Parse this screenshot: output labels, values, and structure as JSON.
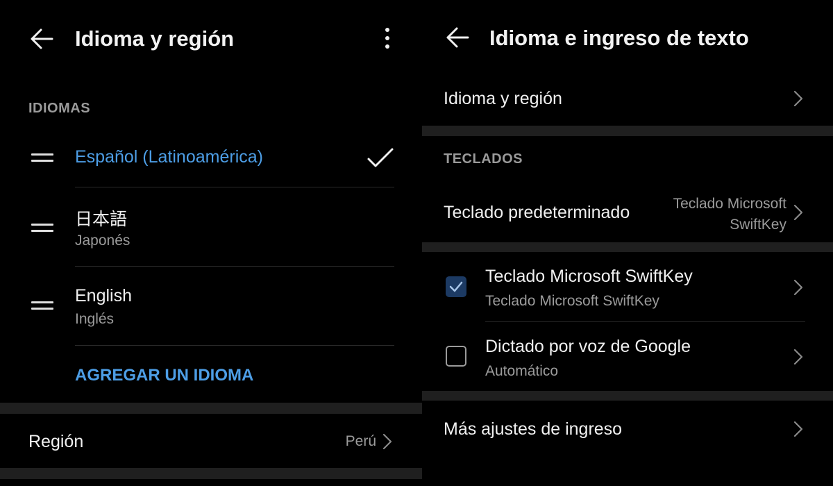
{
  "left": {
    "title": "Idioma y región",
    "languages_header": "IDIOMAS",
    "languages": [
      {
        "name": "Español (Latinoamérica)",
        "subtitle": "",
        "selected": true
      },
      {
        "name": "日本語",
        "subtitle": "Japonés",
        "selected": false
      },
      {
        "name": "English",
        "subtitle": "Inglés",
        "selected": false
      }
    ],
    "add_language": "AGREGAR UN IDIOMA",
    "region_label": "Región",
    "region_value": "Perú"
  },
  "right": {
    "title": "Idioma e ingreso de texto",
    "language_region": "Idioma y región",
    "keyboards_header": "TECLADOS",
    "default_keyboard_label": "Teclado predeterminado",
    "default_keyboard_value_line1": "Teclado Microsoft",
    "default_keyboard_value_line2": "SwiftKey",
    "keyboards": [
      {
        "name": "Teclado Microsoft SwiftKey",
        "subtitle": "Teclado Microsoft SwiftKey",
        "checked": true
      },
      {
        "name": "Dictado por voz de Google",
        "subtitle": "Automático",
        "checked": false
      }
    ],
    "more_settings": "Más ajustes de ingreso"
  },
  "colors": {
    "accent": "#4d9ee6",
    "background": "#000000",
    "band": "#1f1f1f",
    "checkbox_checked": "#1c3a63"
  },
  "icons": [
    "back-arrow-icon",
    "more-vert-icon",
    "drag-handle-icon",
    "checkmark-icon",
    "chevron-right-icon",
    "checkbox-icon"
  ]
}
